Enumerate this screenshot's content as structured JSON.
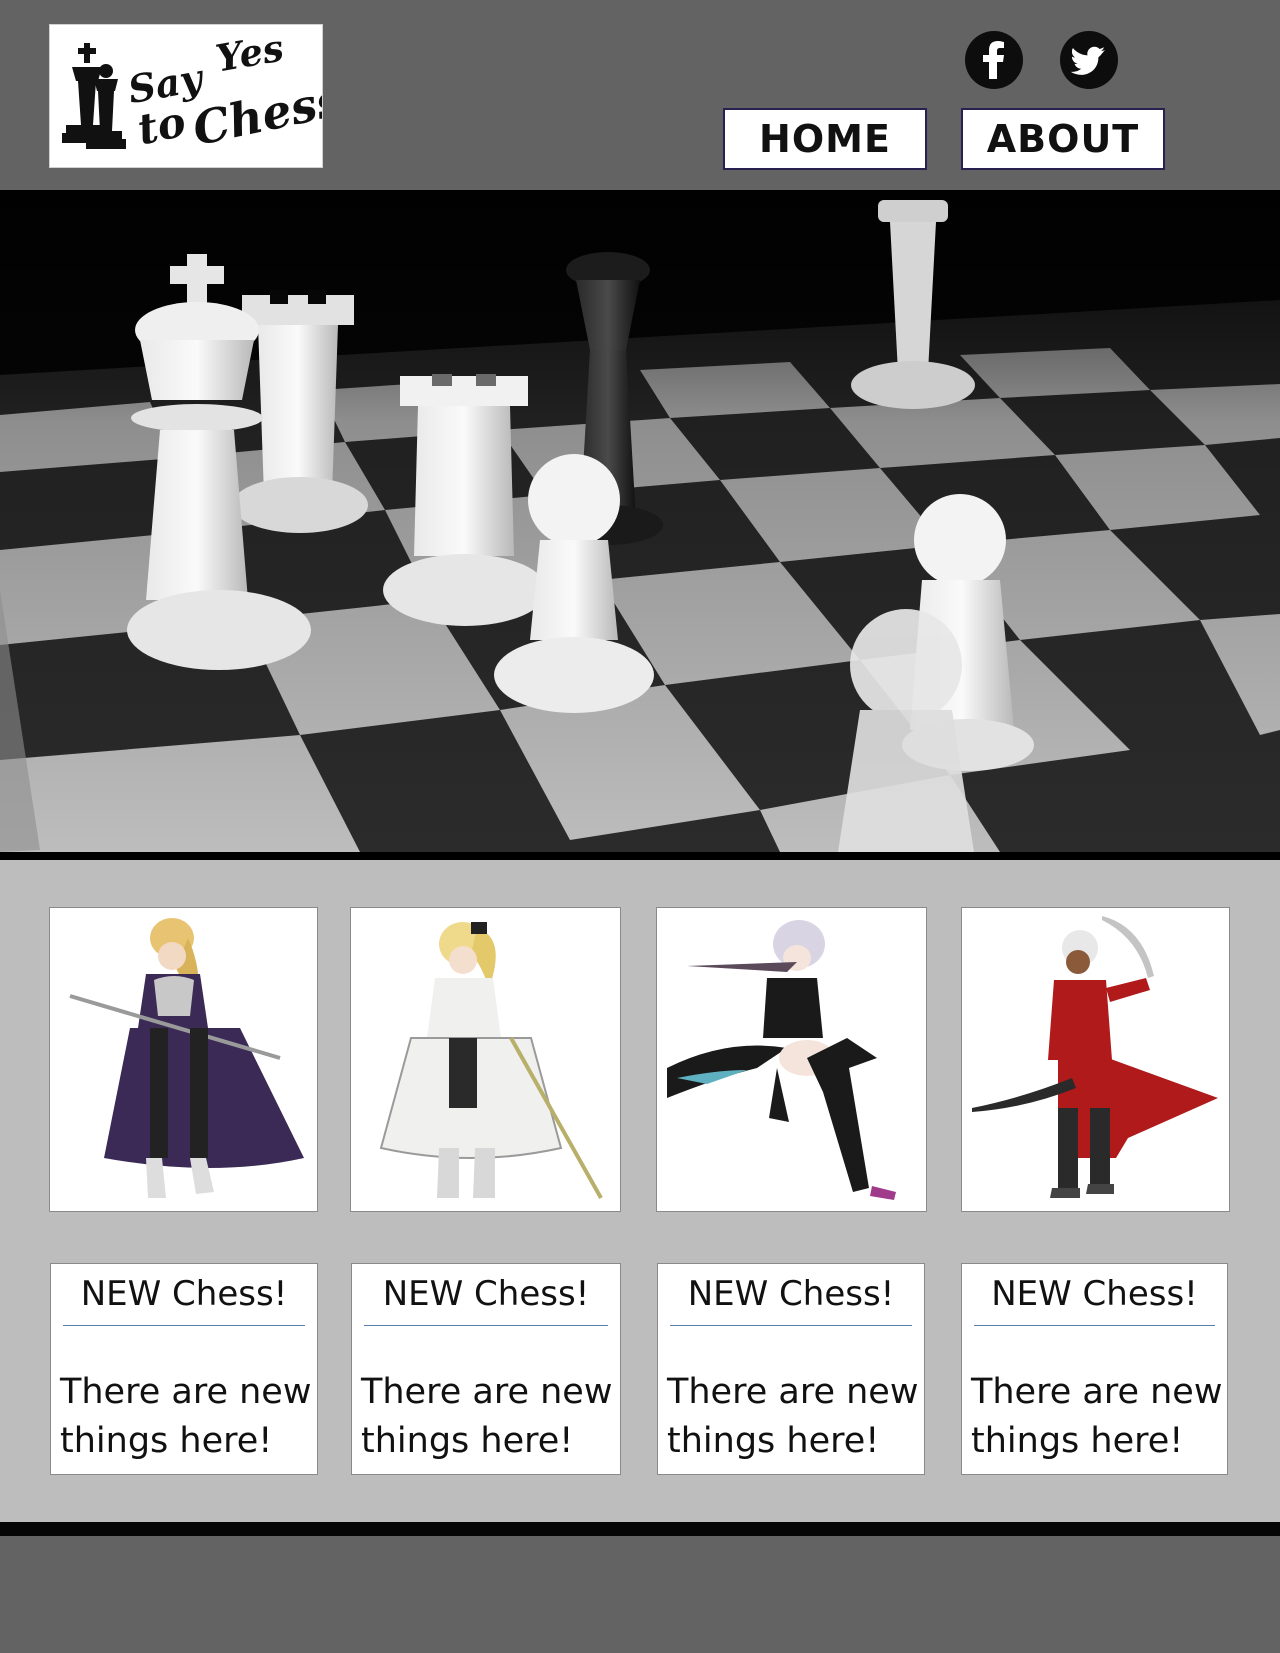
{
  "site": {
    "logo": {
      "line1a": "Say",
      "line1b": "Yes",
      "line2a": "to",
      "line2b": "Chess"
    },
    "social": [
      {
        "icon": "facebook-icon"
      },
      {
        "icon": "twitter-icon"
      }
    ],
    "nav": {
      "home_label": "HOME",
      "about_label": "ABOUT"
    }
  },
  "cards": [
    {
      "title": "NEW Chess!",
      "body_line1": "There are new",
      "body_line2": "things here!"
    },
    {
      "title": "NEW Chess!",
      "body_line1": "There are new",
      "body_line2": "things here!"
    },
    {
      "title": "NEW Chess!",
      "body_line1": "There are new",
      "body_line2": "things here!"
    },
    {
      "title": "NEW Chess!",
      "body_line1": "There are new",
      "body_line2": "things here!"
    }
  ],
  "colors": {
    "page_bg": "#636363",
    "cards_bg": "#bdbdbd",
    "rule": "#050505",
    "card_divider": "#5b7fa8",
    "character_1": "#3a2a55",
    "character_2": "#f0f0ee",
    "character_3": "#1a1a1a",
    "character_4": "#b01a1a"
  }
}
